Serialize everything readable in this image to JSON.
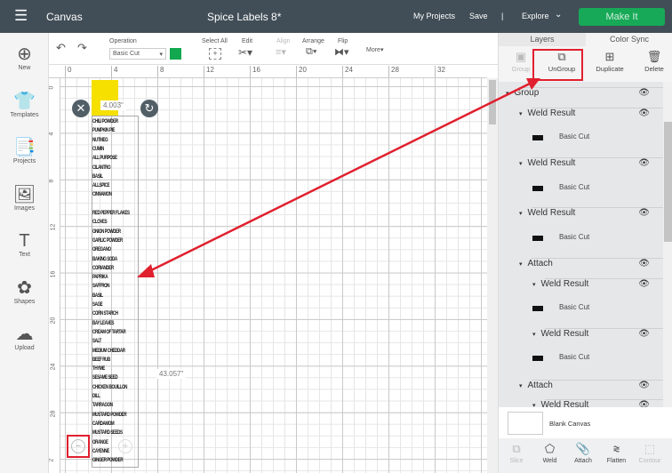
{
  "header": {
    "menu_icon": "hamburger-icon",
    "app": "Canvas",
    "title": "Spice Labels 8*",
    "my_projects": "My Projects",
    "save": "Save",
    "sep": "|",
    "explore": "Explore",
    "make_it": "Make It",
    "accent": "#17a957"
  },
  "sidebar": [
    {
      "label": "New",
      "icon": "plus-circle-icon"
    },
    {
      "label": "Templates",
      "icon": "shirt-icon"
    },
    {
      "label": "Projects",
      "icon": "projects-icon"
    },
    {
      "label": "Images",
      "icon": "image-icon"
    },
    {
      "label": "Text",
      "icon": "text-icon"
    },
    {
      "label": "Shapes",
      "icon": "shapes-icon"
    },
    {
      "label": "Upload",
      "icon": "upload-icon"
    }
  ],
  "toolbar": {
    "operation_label": "Operation",
    "operation_value": "Basic Cut",
    "operation_color": "#12a84f",
    "select_all": "Select All",
    "edit": "Edit",
    "align": "Align",
    "arrange": "Arrange",
    "flip": "Flip",
    "more": "More▾"
  },
  "ruler": {
    "top": [
      "0",
      "4",
      "8",
      "12",
      "16",
      "20",
      "24",
      "28",
      "32"
    ],
    "left": [
      "0",
      "4",
      "8",
      "12",
      "16",
      "20",
      "24",
      "28",
      "2"
    ]
  },
  "canvas": {
    "width_label": "4.003\"",
    "height_label": "43.057\"",
    "spices": [
      "CHILI POWDER",
      "PUMPKIN PIE",
      "NUTMEG",
      "CUMIN",
      "ALL PURPOSE",
      "CILANTRO",
      "BASIL",
      "ALLSPICE",
      "CINNAMON",
      "",
      "RED PEPPER FLAKES",
      "CLOVES",
      "ONION POWDER",
      "GARLIC POWDER",
      "OREGANO",
      "BAKING SODA",
      "CORIANDER",
      "PAPRIKA",
      "SAFFRON",
      "BASIL",
      "SAGE",
      "CORN STARCH",
      "BAY LEAVES",
      "CREAM OF TARTAR",
      "SALT",
      "MEDIUM CHEDDAR",
      "BEEF RUB",
      "THYME",
      "SESAME SEED",
      "CHICKEN BOUILLON",
      "DILL",
      "TARRAGON",
      "MUSTARD POWDER",
      "CARDAMOM",
      "MUSTARD SEEDS",
      "ORANGE",
      "CAYENNE",
      "GINGER POWDER"
    ]
  },
  "panel": {
    "tabs": [
      "Layers",
      "Color Sync"
    ],
    "actions": [
      "Group",
      "UnGroup",
      "Duplicate",
      "Delete"
    ],
    "layers": [
      {
        "label": "Group",
        "level": 0,
        "kind": "head"
      },
      {
        "label": "Weld Result",
        "level": 1,
        "kind": "head"
      },
      {
        "label": "Basic Cut",
        "level": 1,
        "kind": "leaf"
      },
      {
        "label": "Weld Result",
        "level": 1,
        "kind": "head"
      },
      {
        "label": "Basic Cut",
        "level": 1,
        "kind": "leaf"
      },
      {
        "label": "Weld Result",
        "level": 1,
        "kind": "head"
      },
      {
        "label": "Basic Cut",
        "level": 1,
        "kind": "leaf"
      },
      {
        "label": "Attach",
        "level": 1,
        "kind": "head"
      },
      {
        "label": "Weld Result",
        "level": 2,
        "kind": "head"
      },
      {
        "label": "Basic Cut",
        "level": 1,
        "kind": "leaf"
      },
      {
        "label": "Weld Result",
        "level": 2,
        "kind": "head"
      },
      {
        "label": "Basic Cut",
        "level": 1,
        "kind": "leaf"
      },
      {
        "label": "Attach",
        "level": 1,
        "kind": "head"
      },
      {
        "label": "Weld Result",
        "level": 2,
        "kind": "head"
      }
    ],
    "blank_canvas": "Blank Canvas",
    "tools": [
      "Slice",
      "Weld",
      "Attach",
      "Flatten",
      "Contour"
    ]
  },
  "annotation_color": "#e0202e"
}
